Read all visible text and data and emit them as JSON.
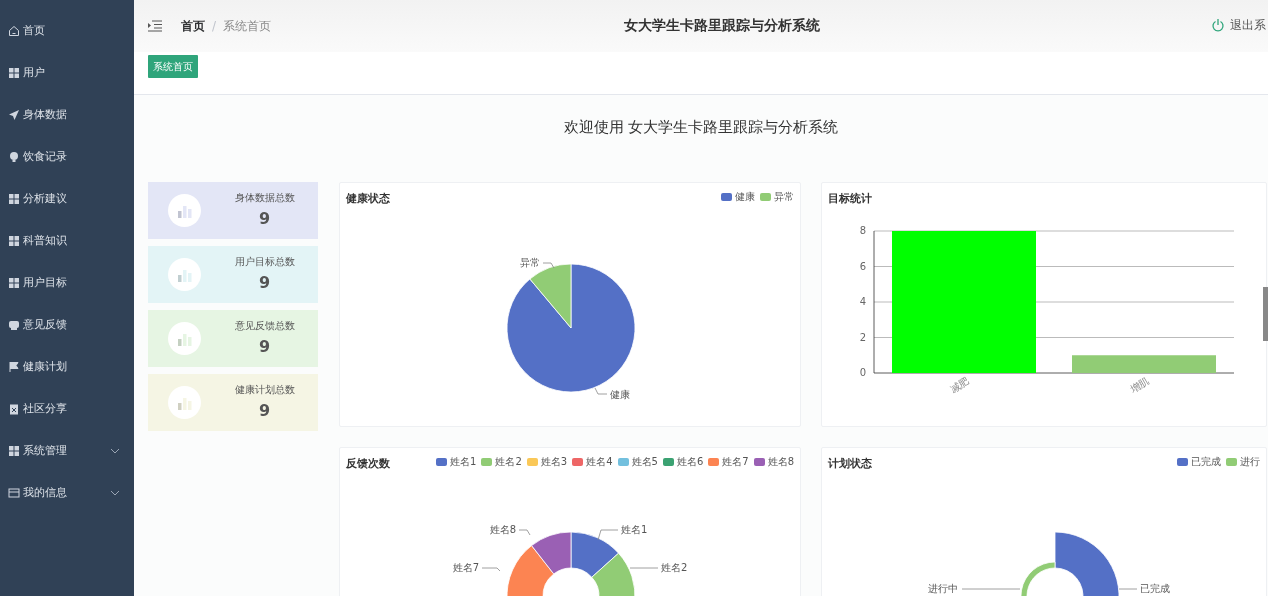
{
  "sidebar": {
    "items": [
      {
        "label": "首页",
        "expandable": false
      },
      {
        "label": "用户",
        "expandable": false
      },
      {
        "label": "身体数据",
        "expandable": false
      },
      {
        "label": "饮食记录",
        "expandable": false
      },
      {
        "label": "分析建议",
        "expandable": false
      },
      {
        "label": "科普知识",
        "expandable": false
      },
      {
        "label": "用户目标",
        "expandable": false
      },
      {
        "label": "意见反馈",
        "expandable": false
      },
      {
        "label": "健康计划",
        "expandable": false
      },
      {
        "label": "社区分享",
        "expandable": false
      },
      {
        "label": "系统管理",
        "expandable": true
      },
      {
        "label": "我的信息",
        "expandable": true
      }
    ]
  },
  "header": {
    "breadcrumb": [
      "首页",
      "/",
      "系统首页"
    ],
    "title": "女大学生卡路里跟踪与分析系统",
    "logout": "退出系"
  },
  "tabs": [
    {
      "label": "系统首页",
      "selected": true
    }
  ],
  "welcome": "欢迎使用 女大学生卡路里跟踪与分析系统",
  "stats": [
    {
      "label": "身体数据总数",
      "value": "9",
      "color": "#e3e6f6"
    },
    {
      "label": "用户目标总数",
      "value": "9",
      "color": "#e3f4f6"
    },
    {
      "label": "意见反馈总数",
      "value": "9",
      "color": "#e6f5e3"
    },
    {
      "label": "健康计划总数",
      "value": "9",
      "color": "#f5f5e4"
    }
  ],
  "charts": [
    {
      "kind": "pie",
      "title": "健康状态",
      "legend": [
        {
          "label": "健康",
          "color": "#5470c6"
        },
        {
          "label": "异常",
          "color": "#91cc75"
        }
      ],
      "slice_labels": [
        "异常",
        "健康"
      ]
    },
    {
      "kind": "bar",
      "title": "目标统计",
      "chart_data": {
        "type": "bar",
        "categories": [
          "减肥",
          "增肌"
        ],
        "values": [
          8,
          1
        ],
        "colors": [
          "#00ff00",
          "#91cc75"
        ],
        "ylim": [
          0,
          8
        ],
        "yticks": [
          0,
          2,
          4,
          6,
          8
        ],
        "grid": true
      }
    },
    {
      "kind": "donut",
      "title": "反馈次数",
      "legend": [
        {
          "label": "姓名1",
          "color": "#5470c6"
        },
        {
          "label": "姓名2",
          "color": "#91cc75"
        },
        {
          "label": "姓名3",
          "color": "#fac858"
        },
        {
          "label": "姓名4",
          "color": "#ee6666"
        },
        {
          "label": "姓名5",
          "color": "#73c0de"
        },
        {
          "label": "姓名6",
          "color": "#3ba272"
        },
        {
          "label": "姓名7",
          "color": "#fc8452"
        },
        {
          "label": "姓名8",
          "color": "#9a60b4"
        }
      ],
      "slice_labels": [
        "姓名8",
        "姓名1",
        "姓名7",
        "姓名2"
      ]
    },
    {
      "kind": "rose",
      "title": "计划状态",
      "legend": [
        {
          "label": "已完成",
          "color": "#5470c6"
        },
        {
          "label": "进行",
          "color": "#91cc75"
        }
      ],
      "slice_labels": [
        "进行中",
        "已完成"
      ]
    }
  ]
}
